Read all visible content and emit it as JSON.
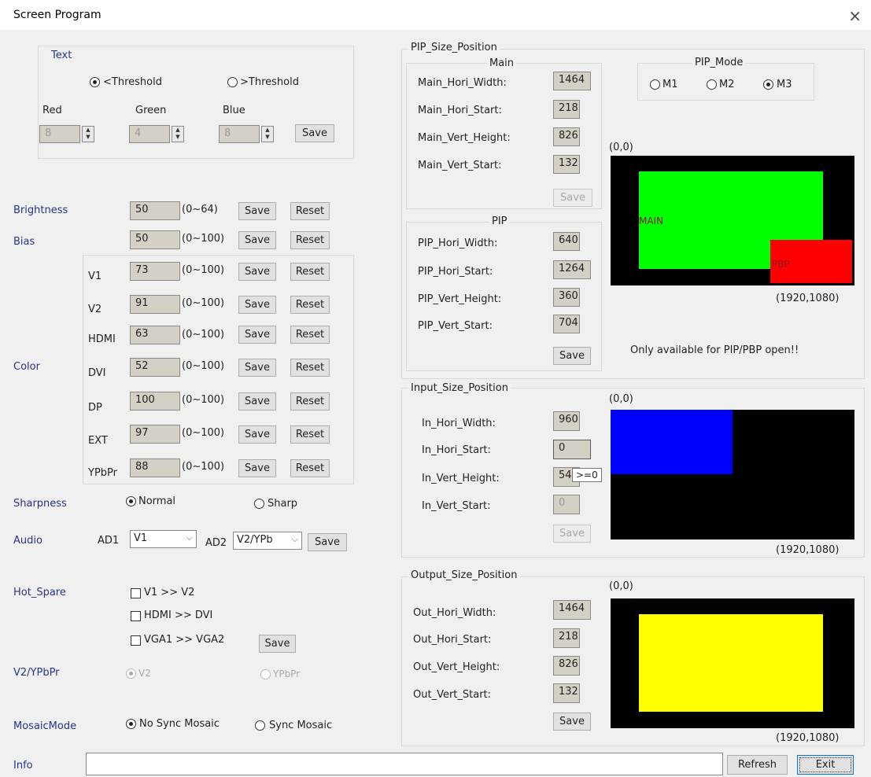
{
  "window": {
    "title": "Screen Program",
    "close_glyph": "×"
  },
  "text_group": {
    "title": "Text",
    "radio_less": "<Threshold",
    "radio_greater": ">Threshold",
    "red_label": "Red",
    "green_label": "Green",
    "blue_label": "Blue",
    "red_value": "8",
    "green_value": "4",
    "blue_value": "8",
    "save": "Save"
  },
  "left": {
    "brightness": {
      "label": "Brightness",
      "value": "50",
      "range": "(0~64)",
      "save": "Save",
      "reset": "Reset"
    },
    "bias": {
      "label": "Bias",
      "value": "50",
      "range": "(0~100)",
      "save": "Save",
      "reset": "Reset"
    },
    "color_label": "Color",
    "color_rows": [
      {
        "name": "V1",
        "value": "73",
        "range": "(0~100)",
        "save": "Save",
        "reset": "Reset"
      },
      {
        "name": "V2",
        "value": "91",
        "range": "(0~100)",
        "save": "Save",
        "reset": "Reset"
      },
      {
        "name": "HDMI",
        "value": "63",
        "range": "(0~100)",
        "save": "Save",
        "reset": "Reset"
      },
      {
        "name": "DVI",
        "value": "52",
        "range": "(0~100)",
        "save": "Save",
        "reset": "Reset"
      },
      {
        "name": "DP",
        "value": "100",
        "range": "(0~100)",
        "save": "Save",
        "reset": "Reset"
      },
      {
        "name": "EXT",
        "value": "97",
        "range": "(0~100)",
        "save": "Save",
        "reset": "Reset"
      },
      {
        "name": "YPbPr",
        "value": "88",
        "range": "(0~100)",
        "save": "Save",
        "reset": "Reset"
      }
    ],
    "sharpness": {
      "label": "Sharpness",
      "normal": "Normal",
      "sharp": "Sharp"
    },
    "audio": {
      "label": "Audio",
      "ad1": "AD1",
      "ad1_value": "V1",
      "ad2": "AD2",
      "ad2_value": "V2/YPb",
      "save": "Save"
    },
    "hot_spare": {
      "label": "Hot_Spare",
      "opt1": "V1  >>  V2",
      "opt2": "HDMI  >>  DVI",
      "opt3": "VGA1  >>  VGA2",
      "save": "Save"
    },
    "v2ypbpr": {
      "label": "V2/YPbPr",
      "opt1": "V2",
      "opt2": "YPbPr"
    },
    "mosaic": {
      "label": "MosaicMode",
      "opt1": "No Sync Mosaic",
      "opt2": "Sync Mosaic"
    },
    "info": {
      "label": "Info",
      "value": ""
    }
  },
  "pip": {
    "group_title": "PIP_Size_Position",
    "main_title": "Main",
    "main_rows": [
      {
        "label": "Main_Hori_Width:",
        "value": "1464"
      },
      {
        "label": "Main_Hori_Start:",
        "value": "218"
      },
      {
        "label": "Main_Vert_Height:",
        "value": "826"
      },
      {
        "label": "Main_Vert_Start:",
        "value": "132"
      }
    ],
    "main_save": "Save",
    "pip_title": "PIP",
    "pip_rows": [
      {
        "label": "PIP_Hori_Width:",
        "value": "640"
      },
      {
        "label": "PIP_Hori_Start:",
        "value": "1264"
      },
      {
        "label": "PIP_Vert_Height:",
        "value": "360"
      },
      {
        "label": "PIP_Vert_Start:",
        "value": "704"
      }
    ],
    "pip_save": "Save",
    "mode_title": "PIP_Mode",
    "m1": "M1",
    "m2": "M2",
    "m3": "M3",
    "origin": "(0,0)",
    "corner": "(1920,1080)",
    "main_tag": "MAIN",
    "pbp_tag": "PBP",
    "note": "Only available for PIP/PBP open!!",
    "colors": {
      "main": "#00ff00",
      "pbp": "#ff0000"
    }
  },
  "input": {
    "group_title": "Input_Size_Position",
    "rows": [
      {
        "label": "In_Hori_Width:",
        "value": "960"
      },
      {
        "label": "In_Hori_Start:",
        "value": "0"
      },
      {
        "label": "In_Vert_Height:",
        "value": "54"
      },
      {
        "label": "In_Vert_Start:",
        "value": "0"
      }
    ],
    "save": "Save",
    "tooltip": ">=0",
    "origin": "(0,0)",
    "corner": "(1920,1080)",
    "colors": {
      "region": "#0000ff"
    }
  },
  "output": {
    "group_title": "Output_Size_Position",
    "rows": [
      {
        "label": "Out_Hori_Width:",
        "value": "1464"
      },
      {
        "label": "Out_Hori_Start:",
        "value": "218"
      },
      {
        "label": "Out_Vert_Height:",
        "value": "826"
      },
      {
        "label": "Out_Vert_Start:",
        "value": "132"
      }
    ],
    "save": "Save",
    "origin": "(0,0)",
    "corner": "(1920,1080)",
    "colors": {
      "region": "#ffff00"
    }
  },
  "footer": {
    "refresh": "Refresh",
    "exit": "Exit"
  }
}
